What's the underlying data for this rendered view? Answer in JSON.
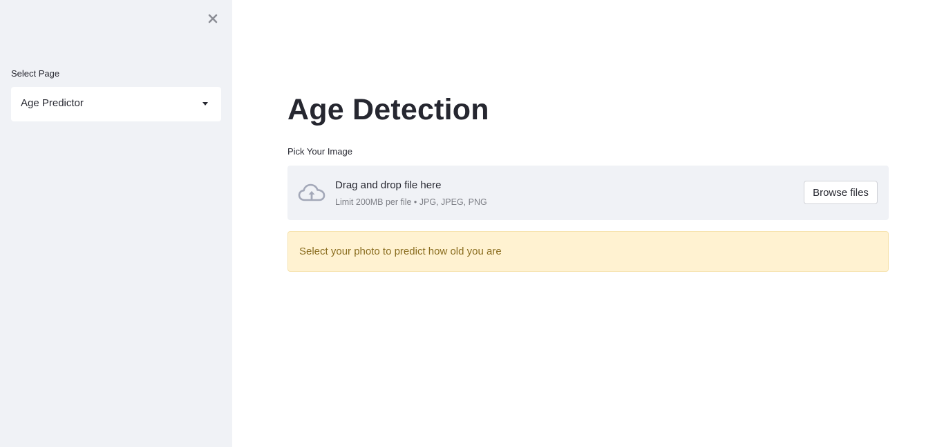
{
  "sidebar": {
    "close_label": "×",
    "select_label": "Select Page",
    "select_value": "Age Predictor"
  },
  "main": {
    "title": "Age Detection",
    "uploader": {
      "label": "Pick Your Image",
      "drop_title": "Drag and drop file here",
      "drop_limit": "Limit 200MB per file • JPG, JPEG, PNG",
      "browse_label": "Browse files",
      "icon": "cloud-upload-icon"
    },
    "alert": {
      "text": "Select your photo to predict how old you are"
    }
  },
  "colors": {
    "sidebar_bg": "#f0f2f6",
    "text": "#262730",
    "alert_bg": "#fff2d1",
    "alert_text": "#8a6d1f",
    "muted_text": "#7d7f86",
    "icon": "#a3a8b8"
  }
}
